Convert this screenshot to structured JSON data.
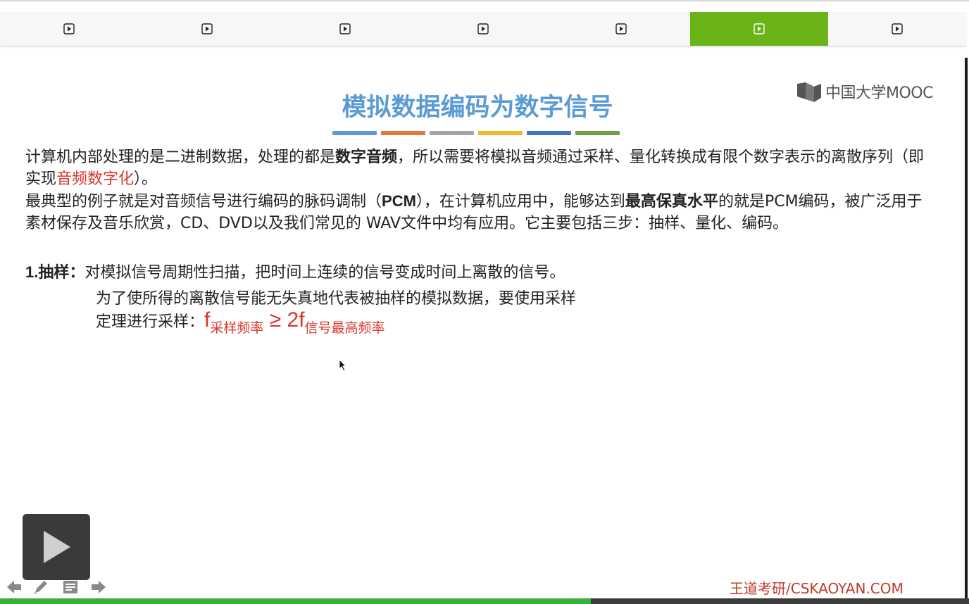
{
  "tabs": [
    {
      "icon": "play-icon",
      "active": false
    },
    {
      "icon": "play-icon",
      "active": false
    },
    {
      "icon": "play-icon",
      "active": false
    },
    {
      "icon": "play-icon",
      "active": false
    },
    {
      "icon": "play-icon",
      "active": false
    },
    {
      "icon": "play-icon",
      "active": true
    },
    {
      "icon": "play-icon",
      "active": false
    }
  ],
  "colors": {
    "active_tab": "#6ab417",
    "title": "#5b9bd5",
    "highlight": "#d9352a",
    "progress": "#38b13a",
    "title_bars": [
      "#5b9bd5",
      "#e07b39",
      "#a5a5a5",
      "#f2b821",
      "#4472c4",
      "#70a044"
    ]
  },
  "logo": {
    "text": "中国大学MOOC"
  },
  "slide": {
    "title": "模拟数据编码为数字信号",
    "para1": {
      "a": "计算机内部处理的是二进制数据，处理的都是",
      "b_bold": "数字音频",
      "c": "，所以需要将模拟音频通过采样、量化转换成有限个数字表示的离散序列（即实现",
      "d_red": "音频数字化",
      "e": "）。"
    },
    "para2": {
      "a": "最典型的例子就是对音频信号进行编码的脉码调制（",
      "b_bold": "PCM",
      "c": "），在计算机应用中，能够达到",
      "d_bold": "最高保真水平",
      "e": "的就是PCM编码，被广泛用于素材保存及音乐欣赏，CD、DVD以及我们常见的 WAV文件中均有应用。它主要包括三步：抽样、量化、编码。"
    },
    "step1": {
      "label": "1.抽样：",
      "line1": "对模拟信号周期性扫描，把时间上连续的信号变成时间上离散的信号。",
      "line2": "为了使所得的离散信号能无失真地代表被抽样的模拟数据，要使用采样",
      "line3": "定理进行采样：",
      "formula": {
        "f1": "f",
        "sub1": "采样频率",
        "op": " ≥ 2f",
        "sub2": "信号最高频率"
      }
    },
    "footer": "王道考研/CSKAOYAN.COM"
  },
  "player": {
    "progress_fraction": 0.61
  }
}
